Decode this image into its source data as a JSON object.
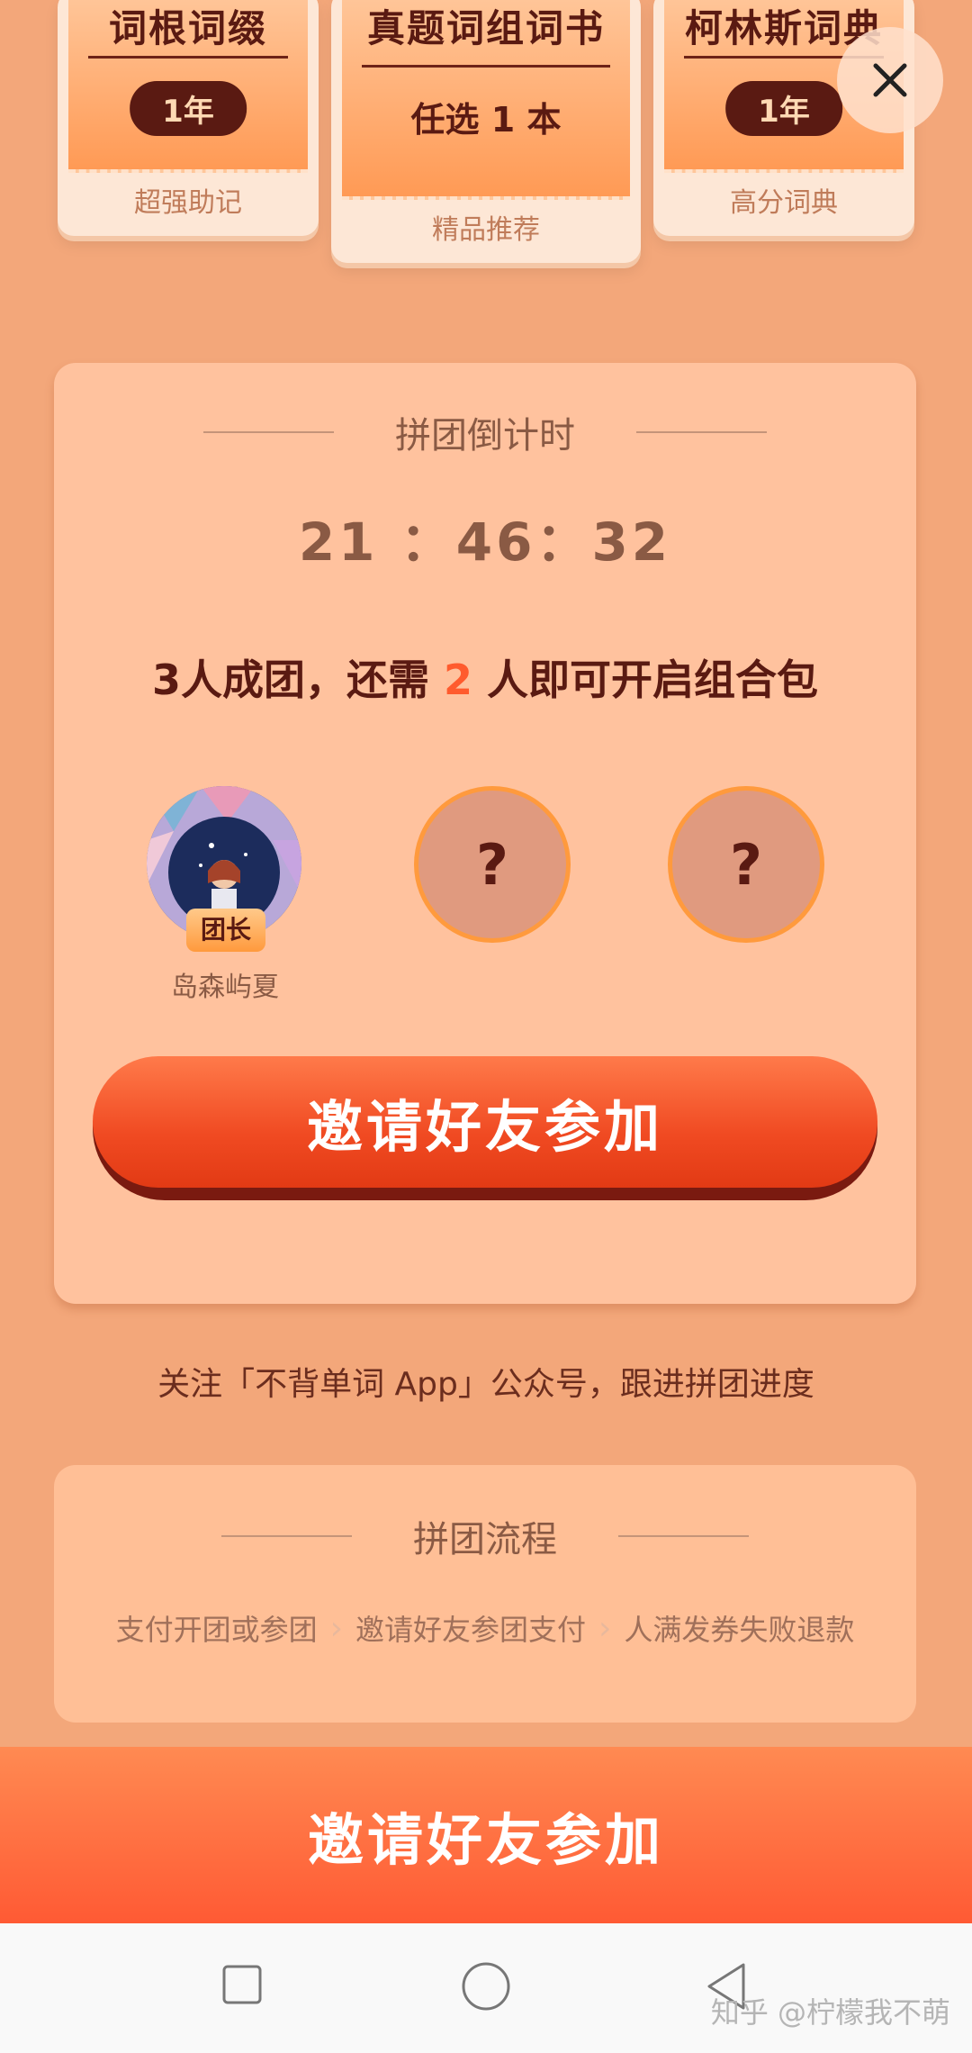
{
  "top_cards": [
    {
      "title": "词根词缀",
      "badge": "1年",
      "footer": "超强助记"
    },
    {
      "title": "真题词组词书",
      "subtitle": "任选 1 本",
      "footer": "精品推荐"
    },
    {
      "title": "柯林斯词典",
      "badge": "1年",
      "footer": "高分词典"
    }
  ],
  "close_icon": "close-icon",
  "group": {
    "section_title": "拼团倒计时",
    "countdown": "21 ：46：32",
    "headline_prefix": "3人成团，还需 ",
    "headline_number": "2",
    "headline_suffix": " 人即可开启组合包",
    "leader_badge": "团长",
    "leader_name": "岛森屿夏",
    "empty_slot_mark": "?",
    "invite_button": "邀请好友参加"
  },
  "follow_text": "关注「不背单词 App」公众号，跟进拼团进度",
  "flow": {
    "section_title": "拼团流程",
    "steps": [
      "支付开团或参团",
      "邀请好友参团支付",
      "人满发券失败退款"
    ]
  },
  "bottom_button": "邀请好友参加",
  "watermark": "知乎 @柠檬我不萌",
  "colors": {
    "background": "#f3a77a",
    "accent": "#ff5b2e",
    "dark_text": "#5a1a12"
  }
}
